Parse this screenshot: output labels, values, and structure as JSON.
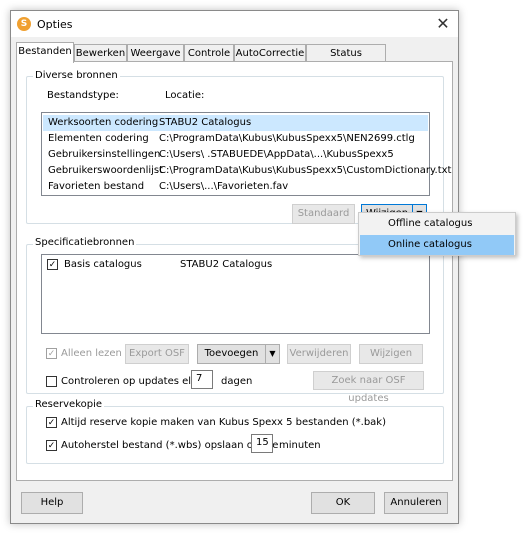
{
  "window": {
    "title": "Opties",
    "app_icon": "S",
    "close_glyph": "✕"
  },
  "tabs": [
    {
      "label": "Bestanden",
      "active": true
    },
    {
      "label": "Bewerken"
    },
    {
      "label": "Weergave"
    },
    {
      "label": "Controle"
    },
    {
      "label": "AutoCorrectie"
    },
    {
      "label": "Status weergave"
    }
  ],
  "sources": {
    "group_title": "Diverse bronnen",
    "col_type": "Bestandstype:",
    "col_location": "Locatie:",
    "rows": [
      {
        "type": "Werksoorten codering",
        "location": "STABU2 Catalogus"
      },
      {
        "type": "Elementen codering",
        "location": "C:\\ProgramData\\Kubus\\KubusSpexx5\\NEN2699.ctlg"
      },
      {
        "type": "Gebruikersinstellingen",
        "location": "C:\\Users\\              .STABUEDE\\AppData\\...\\KubusSpexx5"
      },
      {
        "type": "Gebruikerswoordenlijst",
        "location": "C:\\ProgramData\\Kubus\\KubusSpexx5\\CustomDictionary.txt"
      },
      {
        "type": "Favorieten bestand",
        "location": "C:\\Users\\...\\Favorieten.fav"
      }
    ],
    "standaard_button": "Standaard",
    "wijzigen_button": "Wijzigen"
  },
  "dropdown_menu": {
    "items": [
      "Offline catalogus",
      "Online catalogus"
    ],
    "highlighted": "Online catalogus"
  },
  "spec": {
    "group_title": "Specificatiebronnen",
    "item": {
      "name": "Basis catalogus",
      "value": "STABU2 Catalogus",
      "checked": true
    },
    "readonly_label": "Alleen lezen",
    "export_button": "Export OSF",
    "add_button": "Toevoegen",
    "remove_button": "Verwijderen",
    "change_button": "Wijzigen",
    "check_updates_label": "Controleren op updates elke",
    "check_updates_value": "7",
    "days_label": "dagen",
    "search_updates_button": "Zoek naar OSF updates"
  },
  "backup": {
    "group_title": "Reservekopie",
    "always_backup_label": "Altijd reserve kopie maken van Kubus Spexx 5  bestanden (*.bak)",
    "autosave_label": "Autoherstel bestand (*.wbs) opslaan om de",
    "autosave_value": "15",
    "minutes_label": "minuten"
  },
  "footer": {
    "help_button": "Help",
    "ok_button": "OK",
    "cancel_button": "Annuleren"
  }
}
